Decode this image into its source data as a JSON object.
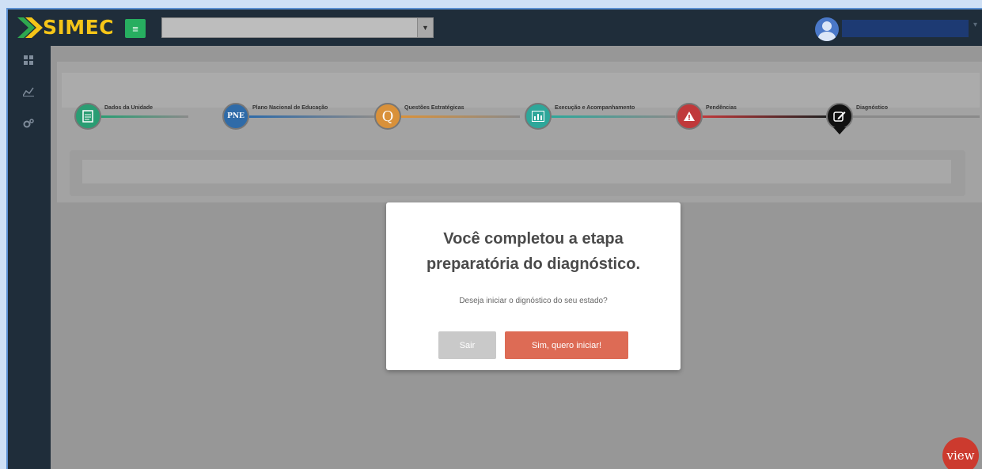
{
  "app": {
    "name": "SIMEC"
  },
  "header": {
    "menu_icon": "menu-icon",
    "select_value": "",
    "user_name": ""
  },
  "sidebar": {
    "items": [
      {
        "icon": "dashboard-icon"
      },
      {
        "icon": "chart-icon"
      },
      {
        "icon": "settings-icon"
      }
    ]
  },
  "steps": [
    {
      "label": "Dados da Unidade",
      "icon": "document-icon",
      "color": "#2a9d73",
      "glyph": ""
    },
    {
      "label": "Plano Nacional de Educação",
      "icon": "pne-icon",
      "color": "#2f6ba8",
      "glyph": "PNE"
    },
    {
      "label": "Questões Estratégicas",
      "icon": "q-icon",
      "color": "#d9913a",
      "glyph": "Q"
    },
    {
      "label": "Execução e Acompanhamento",
      "icon": "bar-chart-icon",
      "color": "#2ea79a",
      "glyph": ""
    },
    {
      "label": "Pendências",
      "icon": "warning-icon",
      "color": "#c0393b",
      "glyph": ""
    },
    {
      "label": "Diagnóstico",
      "icon": "edit-icon",
      "color": "#111111",
      "glyph": ""
    }
  ],
  "modal": {
    "title_line1": "Você completou a etapa",
    "title_line2": "preparatória do diagnóstico.",
    "subtitle": "Deseja iniciar o dignóstico do seu estado?",
    "cancel_label": "Sair",
    "confirm_label": "Sim, quero iniciar!"
  },
  "floating": {
    "view_label": "view"
  }
}
